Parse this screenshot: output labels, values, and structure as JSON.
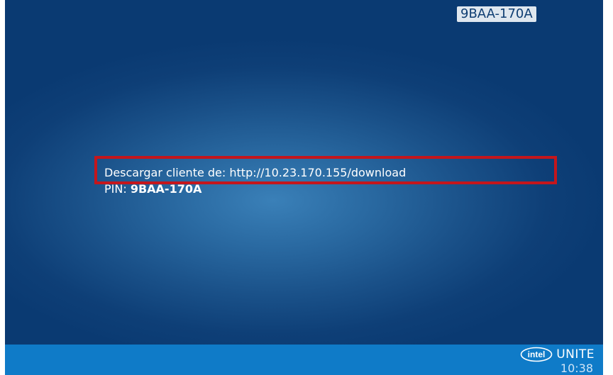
{
  "screen": {
    "pin_badge": "9BAA-170A",
    "download_label": "Descargar cliente de:",
    "download_url": "http://10.23.170.155/download",
    "pin_label": "PIN:",
    "pin_value": "9BAA-170A"
  },
  "taskbar": {
    "logo_text": "intel",
    "brand": "UNITE",
    "clock": "10:38"
  },
  "colors": {
    "background": "#0a3a72",
    "glow": "#3a80b8",
    "taskbar": "#0f7bc8",
    "highlight_border": "#c4161c"
  },
  "icons": {
    "logo": "intel-logo-icon"
  }
}
